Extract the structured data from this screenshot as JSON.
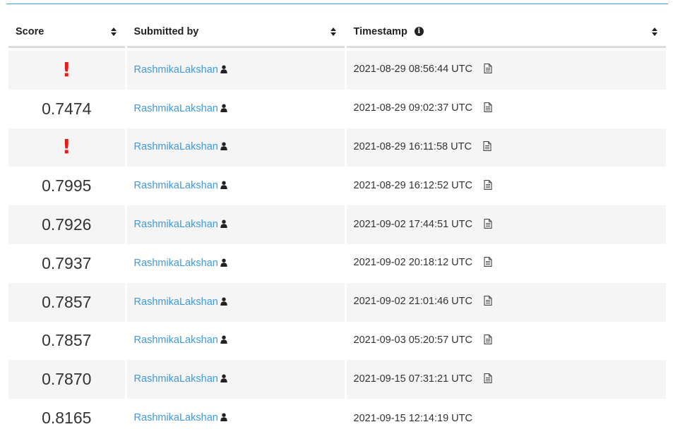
{
  "header": {
    "score": "Score",
    "submitted_by": "Submitted by",
    "timestamp": "Timestamp",
    "timestamp_info_icon": "info-icon",
    "sort_icon": "sort-icon"
  },
  "colors": {
    "link": "#3d9be0",
    "error": "#e21a1a",
    "row_shade": "#f5f5f5",
    "top_rule": "#3d9be0"
  },
  "rows": [
    {
      "score": "",
      "error": "!",
      "user": "RashmikaLakshan",
      "timestamp": "2021-08-29 08:56:44 UTC",
      "has_file": true
    },
    {
      "score": "0.7474",
      "error": "",
      "user": "RashmikaLakshan",
      "timestamp": "2021-08-29 09:02:37 UTC",
      "has_file": true
    },
    {
      "score": "",
      "error": "!",
      "user": "RashmikaLakshan",
      "timestamp": "2021-08-29 16:11:58 UTC",
      "has_file": true
    },
    {
      "score": "0.7995",
      "error": "",
      "user": "RashmikaLakshan",
      "timestamp": "2021-08-29 16:12:52 UTC",
      "has_file": true
    },
    {
      "score": "0.7926",
      "error": "",
      "user": "RashmikaLakshan",
      "timestamp": "2021-09-02 17:44:51 UTC",
      "has_file": true
    },
    {
      "score": "0.7937",
      "error": "",
      "user": "RashmikaLakshan",
      "timestamp": "2021-09-02 20:18:12 UTC",
      "has_file": true
    },
    {
      "score": "0.7857",
      "error": "",
      "user": "RashmikaLakshan",
      "timestamp": "2021-09-02 21:01:46 UTC",
      "has_file": true
    },
    {
      "score": "0.7857",
      "error": "",
      "user": "RashmikaLakshan",
      "timestamp": "2021-09-03 05:20:57 UTC",
      "has_file": true
    },
    {
      "score": "0.7870",
      "error": "",
      "user": "RashmikaLakshan",
      "timestamp": "2021-09-15 07:31:21 UTC",
      "has_file": true
    },
    {
      "score": "0.8165",
      "error": "",
      "user": "RashmikaLakshan",
      "timestamp": "2021-09-15 12:14:19 UTC",
      "has_file": false
    }
  ]
}
